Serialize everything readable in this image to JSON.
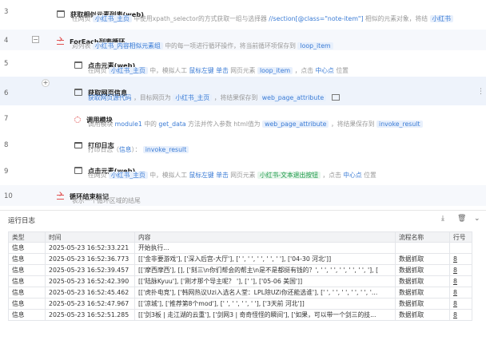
{
  "editor": {
    "rows": [
      {
        "num": "3",
        "title": "获取相似元素列表(web)",
        "desc": [
          "在网页",
          "小红书_主页",
          "中使用xpath_selector的方式获取一组与选择器",
          "//section[@class=\"note-item\"]",
          "相似的元素对象，将结",
          "小红书"
        ]
      },
      {
        "num": "4",
        "title": "ForEach列表循环",
        "desc": [
          "对列表",
          "小红书_内容相似元素组",
          "中的每一项进行循环操作，将当前循环项保存到",
          "loop_item"
        ]
      },
      {
        "num": "5",
        "title": "点击元素(web)",
        "desc": [
          "在网页",
          "小红书_主页",
          "中，模拟人工",
          "鼠标左键",
          "单击",
          "网页元素",
          "loop_item",
          "，点击",
          "中心点",
          "位置"
        ]
      },
      {
        "num": "6",
        "title": "获取网页信息",
        "desc": [
          "获取网页源代码",
          "，目标网页为",
          "小红书_主页",
          "，将结果保存到",
          "web_page_attribute"
        ]
      },
      {
        "num": "7",
        "title": "调用模块",
        "desc": [
          "调用模块",
          "module1",
          "中的",
          "get_data",
          "方法并传入参数",
          "html值为",
          "web_page_attribute",
          "，将结果保存到",
          "invoke_result"
        ]
      },
      {
        "num": "8",
        "title": "打印日志",
        "desc": [
          "打印日志（",
          "信息",
          "）：",
          "invoke_result"
        ]
      },
      {
        "num": "9",
        "title": "点击元素(web)",
        "desc": [
          "在网页",
          "小红书_主页",
          "中，模拟人工",
          "鼠标左键",
          "单击",
          "网页元素",
          "小红书-文本退出按钮",
          "，点击",
          "中心点",
          "位置"
        ]
      },
      {
        "num": "10",
        "title": "循环结束标记",
        "desc": [
          "表示一个循环区域的结尾"
        ]
      }
    ]
  },
  "log": {
    "title": "运行日志",
    "columns": [
      "类型",
      "时间",
      "内容",
      "流程名称",
      "行号"
    ],
    "rows": [
      {
        "type": "信息",
        "time": "2025-05-23 16:52:33.221",
        "content": "开始执行...",
        "flow": "",
        "line": ""
      },
      {
        "type": "信息",
        "time": "2025-05-23 16:52:36.773",
        "content": "[['金非要游戏'], ['深入后宫-大厅'], [' ', ' ', ' ', ' ', ' '], ['04-30 河北']]",
        "flow": "数据抓取",
        "line": "8"
      },
      {
        "type": "信息",
        "time": "2025-05-23 16:52:39.457",
        "content": "[['摩西摩西'], [], ['刻三\\n你们帮会的帮主\\n是不是都挺有钱的？', ' ', ' ', ' ', ' ', ' ', '], [",
        "flow": "数据抓取",
        "line": "8"
      },
      {
        "type": "信息",
        "time": "2025-05-23 16:52:42.390",
        "content": "[['陆脉Kyuu'], ['刚才那个导主呢？ '], [' '], ['05-06 美国']]",
        "flow": "数据抓取",
        "line": "8"
      },
      {
        "type": "信息",
        "time": "2025-05-23 16:52:45.462",
        "content": "[['虎扑电竞'], ['韩网热议Uzi入选名人堂：LPL除UZi你还能选谁'], [' ', ' ', ' ', ' ', ' ', '...",
        "flow": "数据抓取",
        "line": "8"
      },
      {
        "type": "信息",
        "time": "2025-05-23 16:52:47.967",
        "content": "[['凉城'], ['推荐第8个mod'], [' ', ' ', ' ', ' '], ['3天前 河北']]",
        "flow": "数据抓取",
        "line": "8"
      },
      {
        "type": "信息",
        "time": "2025-05-23 16:52:51.285",
        "content": "[['剑3板 | 走江湖的云重'], ['剑网3 | 奇奇怪怪的瞬间'], ['如果，可以带一个剑三的技...",
        "flow": "数据抓取",
        "line": "8"
      }
    ]
  }
}
